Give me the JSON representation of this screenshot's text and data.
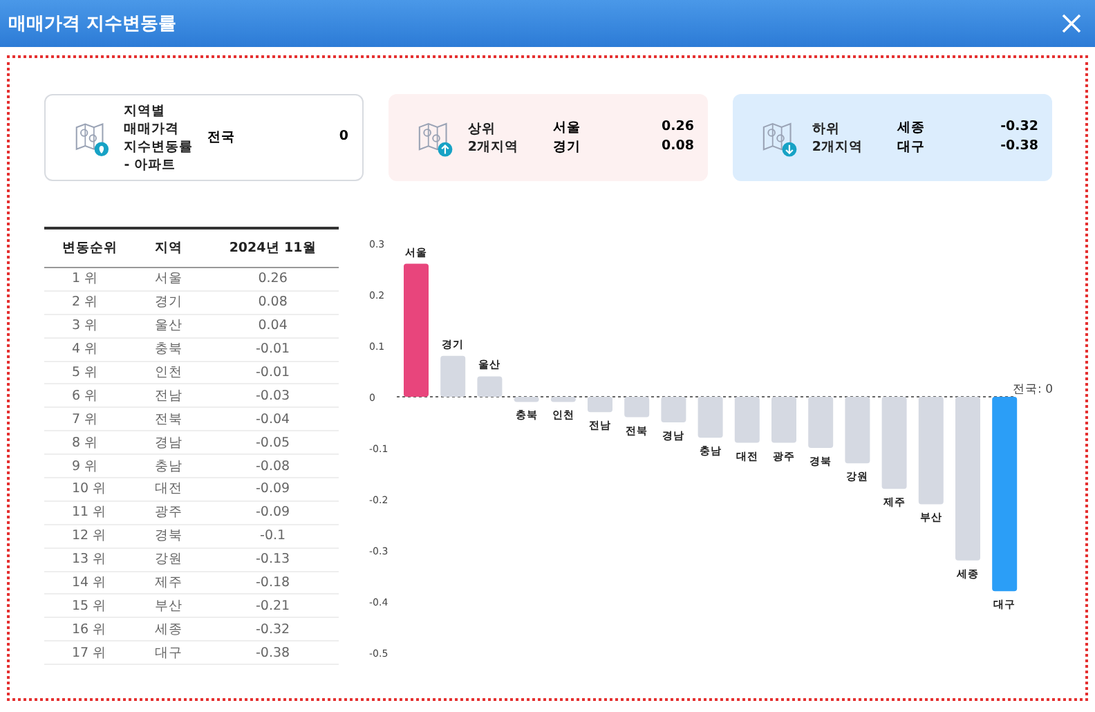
{
  "window": {
    "title": "매매가격 지수변동률"
  },
  "cards": [
    {
      "kind": "all",
      "label": [
        "지역별",
        "매매가격",
        "지수변동률",
        "- 아파트"
      ],
      "items": [
        {
          "region": "전국",
          "value": "0"
        }
      ]
    },
    {
      "kind": "top",
      "label": [
        "상위",
        "2개지역"
      ],
      "items": [
        {
          "region": "서울",
          "value": "0.26"
        },
        {
          "region": "경기",
          "value": "0.08"
        }
      ]
    },
    {
      "kind": "bottom",
      "label": [
        "하위",
        "2개지역"
      ],
      "items": [
        {
          "region": "세종",
          "value": "-0.32"
        },
        {
          "region": "대구",
          "value": "-0.38"
        }
      ]
    }
  ],
  "table": {
    "columns": [
      "변동순위",
      "지역",
      "2024년 11월"
    ],
    "rows": [
      [
        "1 위",
        "서울",
        "0.26"
      ],
      [
        "2 위",
        "경기",
        "0.08"
      ],
      [
        "3 위",
        "울산",
        "0.04"
      ],
      [
        "4 위",
        "충북",
        "-0.01"
      ],
      [
        "5 위",
        "인천",
        "-0.01"
      ],
      [
        "6 위",
        "전남",
        "-0.03"
      ],
      [
        "7 위",
        "전북",
        "-0.04"
      ],
      [
        "8 위",
        "경남",
        "-0.05"
      ],
      [
        "9 위",
        "충남",
        "-0.08"
      ],
      [
        "10 위",
        "대전",
        "-0.09"
      ],
      [
        "11 위",
        "광주",
        "-0.09"
      ],
      [
        "12 위",
        "경북",
        "-0.1"
      ],
      [
        "13 위",
        "강원",
        "-0.13"
      ],
      [
        "14 위",
        "제주",
        "-0.18"
      ],
      [
        "15 위",
        "부산",
        "-0.21"
      ],
      [
        "16 위",
        "세종",
        "-0.32"
      ],
      [
        "17 위",
        "대구",
        "-0.38"
      ]
    ]
  },
  "chart": {
    "chart_data": {
      "type": "bar",
      "categories": [
        "서울",
        "경기",
        "울산",
        "충북",
        "인천",
        "전남",
        "전북",
        "경남",
        "충남",
        "대전",
        "광주",
        "경북",
        "강원",
        "제주",
        "부산",
        "세종",
        "대구"
      ],
      "series": [
        {
          "color": "#e8457c",
          "values": [
            0.26,
            null,
            null,
            null,
            null,
            null,
            null,
            null,
            null,
            null,
            null,
            null,
            null,
            null,
            null,
            null,
            null
          ]
        },
        {
          "color": "#d5d9e2",
          "values": [
            null,
            0.08,
            0.04,
            -0.01,
            -0.01,
            -0.03,
            -0.04,
            -0.05,
            -0.08,
            -0.09,
            -0.09,
            -0.1,
            -0.13,
            -0.18,
            -0.21,
            -0.32,
            null
          ]
        },
        {
          "color": "#2b9ef7",
          "values": [
            null,
            null,
            null,
            null,
            null,
            null,
            null,
            null,
            null,
            null,
            null,
            null,
            null,
            null,
            null,
            null,
            -0.38
          ]
        }
      ],
      "ylim": [
        -0.5,
        0.3
      ],
      "yticks": [
        0.3,
        0.2,
        0.1,
        0,
        -0.1,
        -0.2,
        -0.3,
        -0.4,
        -0.5
      ],
      "annotations": [
        "전국: 0"
      ]
    }
  }
}
